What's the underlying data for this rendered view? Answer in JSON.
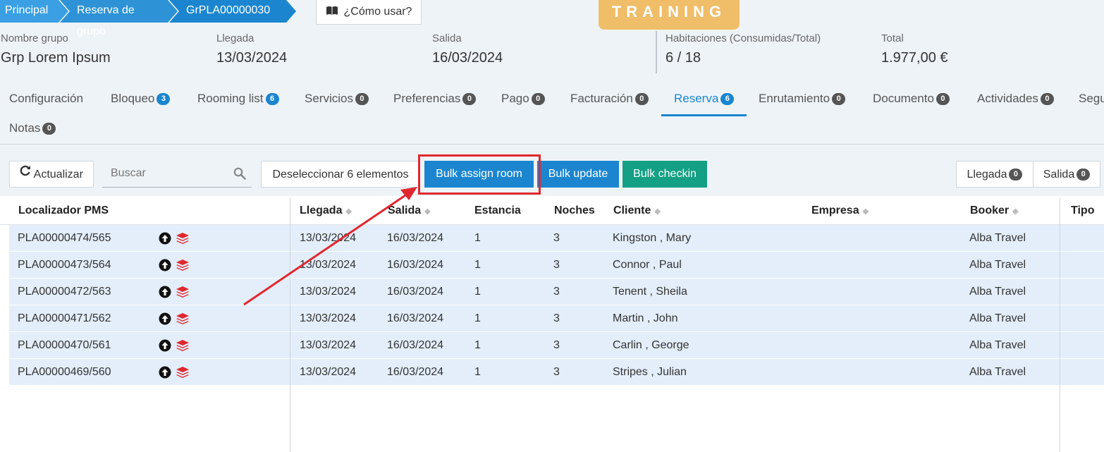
{
  "breadcrumb": [
    "Principal",
    "Reserva de grupo",
    "GrPLA00000030"
  ],
  "howto_label": "¿Cómo usar?",
  "training_label": "TRAINING",
  "info": {
    "group_name_label": "Nombre grupo",
    "group_name": "Grp Lorem Ipsum",
    "arrival_label": "Llegada",
    "arrival": "13/03/2024",
    "departure_label": "Salida",
    "departure": "16/03/2024",
    "rooms_label": "Habitaciones (Consumidas/Total)",
    "rooms": "6 / 18",
    "total_label": "Total",
    "total": "1.977,00 €"
  },
  "tabs": [
    {
      "label": "Configuración",
      "count": ""
    },
    {
      "label": "Bloqueo",
      "count": "3"
    },
    {
      "label": "Rooming list",
      "count": "6"
    },
    {
      "label": "Servicios",
      "count": "0"
    },
    {
      "label": "Preferencias",
      "count": "0"
    },
    {
      "label": "Pago",
      "count": "0"
    },
    {
      "label": "Facturación",
      "count": "0"
    },
    {
      "label": "Reserva",
      "count": "6"
    },
    {
      "label": "Enrutamiento",
      "count": "0"
    },
    {
      "label": "Documento",
      "count": "0"
    },
    {
      "label": "Actividades",
      "count": "0"
    },
    {
      "label": "Segu",
      "count": ""
    },
    {
      "label": "Notas",
      "count": "0"
    }
  ],
  "toolbar": {
    "refresh": "Actualizar",
    "search_placeholder": "Buscar",
    "deselect": "Deseleccionar 6 elementos",
    "bulk_assign": "Bulk assign room",
    "bulk_update": "Bulk update",
    "bulk_checkin": "Bulk checkin",
    "arrival_filter": "Llegada",
    "arrival_count": "0",
    "departure_filter": "Salida",
    "departure_count": "0"
  },
  "table": {
    "headers": {
      "locator": "Localizador PMS",
      "arrival": "Llegada",
      "departure": "Salida",
      "stay": "Estancia",
      "nights": "Noches",
      "client": "Cliente",
      "company": "Empresa",
      "booker": "Booker",
      "type": "Tipo"
    },
    "rows": [
      {
        "locator": "PLA00000474/565",
        "arrival": "13/03/2024",
        "departure": "16/03/2024",
        "stay": "1",
        "nights": "3",
        "client": "Kingston , Mary",
        "company": "",
        "booker": "Alba Travel"
      },
      {
        "locator": "PLA00000473/564",
        "arrival": "13/03/2024",
        "departure": "16/03/2024",
        "stay": "1",
        "nights": "3",
        "client": "Connor , Paul",
        "company": "",
        "booker": "Alba Travel"
      },
      {
        "locator": "PLA00000472/563",
        "arrival": "13/03/2024",
        "departure": "16/03/2024",
        "stay": "1",
        "nights": "3",
        "client": "Tenent , Sheila",
        "company": "",
        "booker": "Alba Travel"
      },
      {
        "locator": "PLA00000471/562",
        "arrival": "13/03/2024",
        "departure": "16/03/2024",
        "stay": "1",
        "nights": "3",
        "client": "Martin , John",
        "company": "",
        "booker": "Alba Travel"
      },
      {
        "locator": "PLA00000470/561",
        "arrival": "13/03/2024",
        "departure": "16/03/2024",
        "stay": "1",
        "nights": "3",
        "client": "Carlin , George",
        "company": "",
        "booker": "Alba Travel"
      },
      {
        "locator": "PLA00000469/560",
        "arrival": "13/03/2024",
        "departure": "16/03/2024",
        "stay": "1",
        "nights": "3",
        "client": "Stripes , Julian",
        "company": "",
        "booker": "Alba Travel"
      }
    ]
  },
  "colors": {
    "primary": "#1b86cf",
    "success": "#14a085",
    "training": "#f0bd68",
    "highlight": "#e0282f",
    "row_selected": "#e3eefa"
  },
  "icons": {
    "howto": "book-icon",
    "refresh": "refresh-icon",
    "search": "search-icon",
    "row_upload": "arrow-up-circle-icon",
    "row_layers": "layers-icon"
  }
}
